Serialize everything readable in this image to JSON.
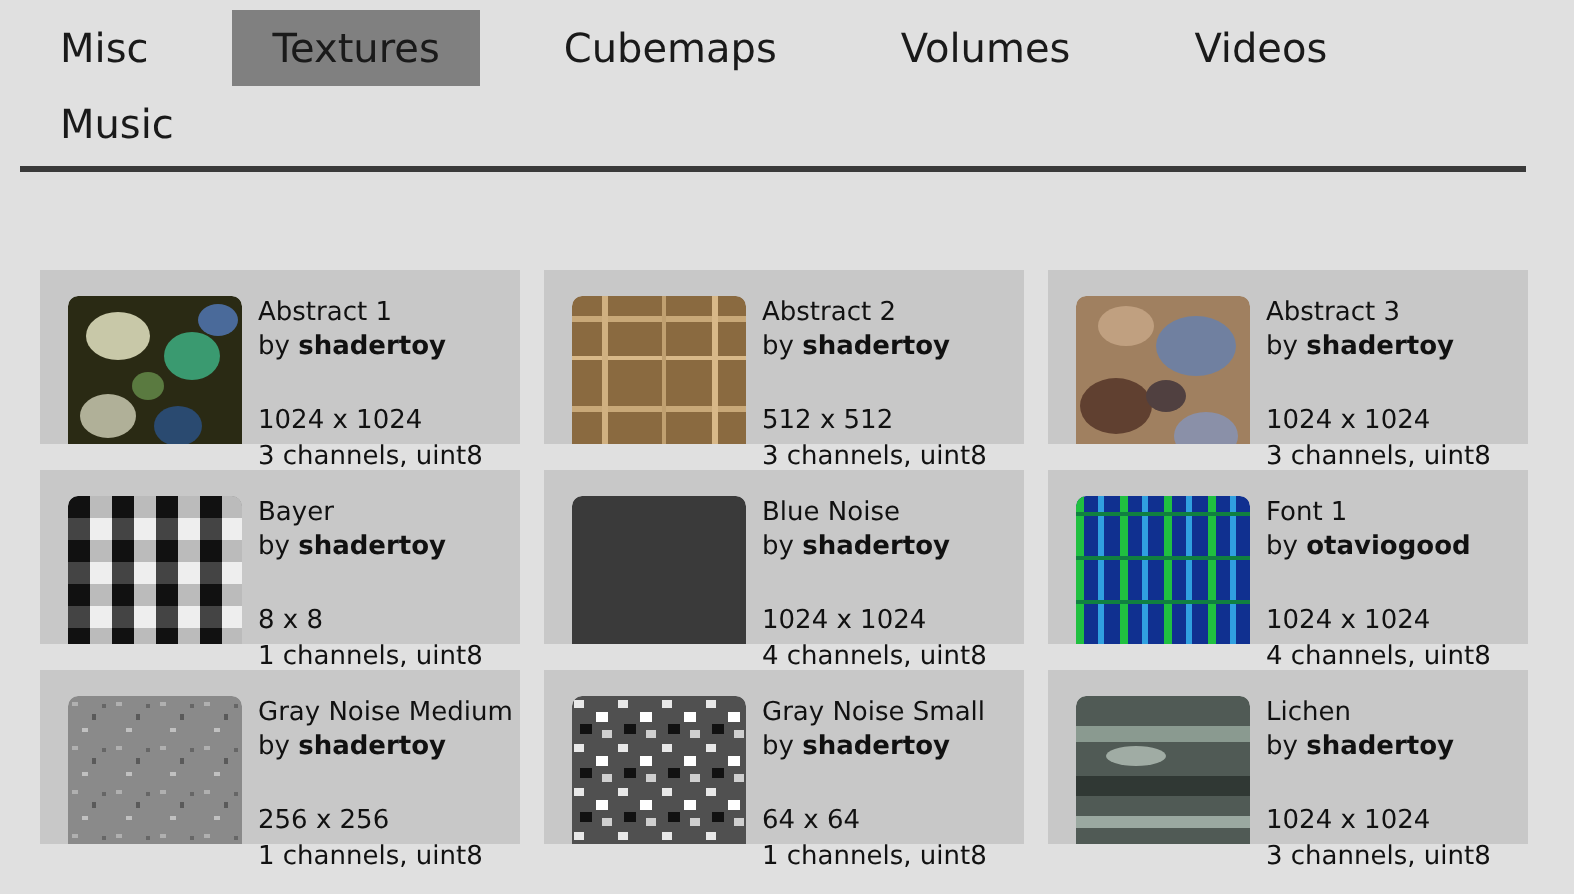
{
  "tabs": [
    {
      "label": "Misc",
      "selected": false
    },
    {
      "label": "Textures",
      "selected": true
    },
    {
      "label": "Cubemaps",
      "selected": false
    },
    {
      "label": "Volumes",
      "selected": false
    },
    {
      "label": "Videos",
      "selected": false
    },
    {
      "label": "Music",
      "selected": false
    }
  ],
  "cards": [
    {
      "title": "Abstract 1",
      "author": "by **shadertoy**",
      "size": "1024 x 1024",
      "format": "3 channels, uint8"
    },
    {
      "title": "Abstract 2",
      "author": "by **shadertoy**",
      "size": "512 x 512",
      "format": "3 channels, uint8"
    },
    {
      "title": "Abstract 3",
      "author": "by **shadertoy**",
      "size": "1024 x 1024",
      "format": "3 channels, uint8"
    },
    {
      "title": "Bayer",
      "author": "by **shadertoy**",
      "size": "8 x 8",
      "format": "1 channels, uint8"
    },
    {
      "title": "Blue Noise",
      "author": "by **shadertoy**",
      "size": "1024 x 1024",
      "format": "4 channels, uint8"
    },
    {
      "title": "Font 1",
      "author": "by **otaviogood**",
      "size": "1024 x 1024",
      "format": "4 channels, uint8"
    },
    {
      "title": "Gray Noise Medium",
      "author": "by **shadertoy**",
      "size": "256 x 256",
      "format": "1 channels, uint8"
    },
    {
      "title": "Gray Noise Small",
      "author": "by **shadertoy**",
      "size": "64 x 64",
      "format": "1 channels, uint8"
    },
    {
      "title": "Lichen",
      "author": "by **shadertoy**",
      "size": "1024 x 1024",
      "format": "3 channels, uint8"
    }
  ]
}
